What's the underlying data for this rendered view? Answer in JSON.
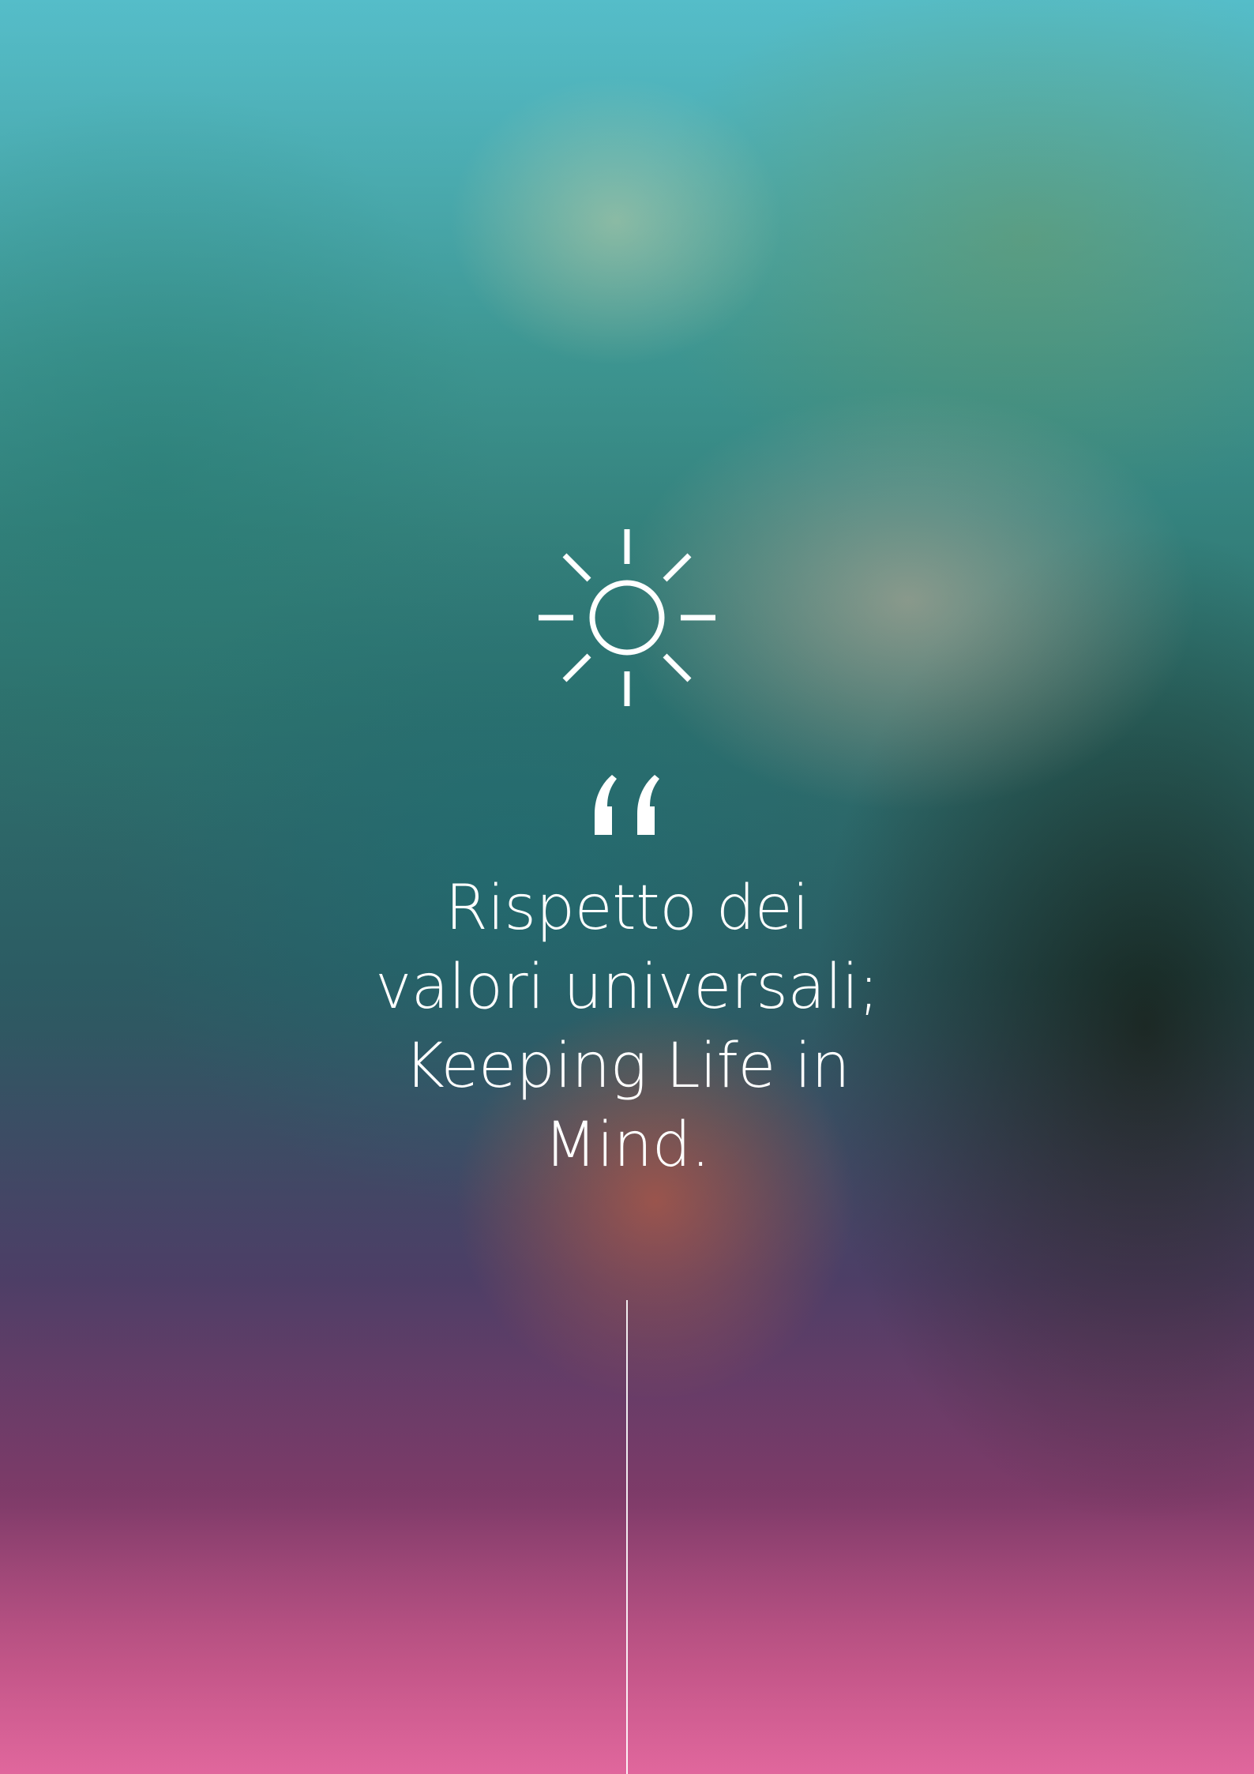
{
  "quote": {
    "lines": [
      "Rispetto dei",
      "valori universali;",
      "Keeping Life in",
      "Mind."
    ]
  },
  "icons": {
    "top": "sun-icon",
    "quote": "quotation-mark-icon"
  },
  "colors": {
    "text": "#ffffff",
    "wash_top": "#50c8d2",
    "wash_bottom": "#e664a0"
  }
}
